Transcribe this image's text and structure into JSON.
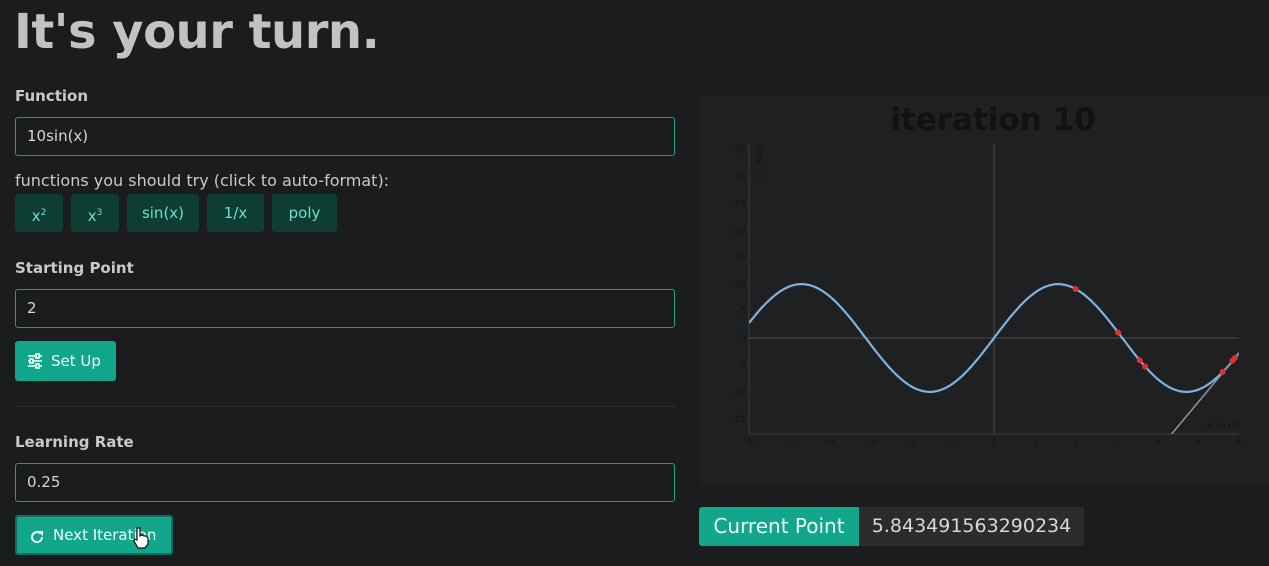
{
  "page": {
    "title": "It's your turn."
  },
  "function": {
    "label": "Function",
    "value": "10sin(x)",
    "hint": "functions you should try (click to auto-format):",
    "suggestions": [
      {
        "base": "x",
        "sup": "2"
      },
      {
        "base": "x",
        "sup": "3"
      },
      {
        "base": "sin(x)",
        "sup": ""
      },
      {
        "base": "1/x",
        "sup": ""
      },
      {
        "base": "poly",
        "sup": ""
      }
    ]
  },
  "starting_point": {
    "label": "Starting Point",
    "value": "2",
    "setup_label": "Set Up",
    "setup_icon": "sliders-icon"
  },
  "learning_rate": {
    "label": "Learning Rate",
    "value": "0.25",
    "next_label": "Next Iteration",
    "next_icon": "refresh-icon"
  },
  "current_point": {
    "label": "Current Point",
    "value": "5.843491563290234"
  },
  "colors": {
    "accent": "#12a68a",
    "curve": "#7fb2e0",
    "points": "#e0302e",
    "tangent": "#8a9096"
  },
  "chart_data": {
    "type": "line",
    "title": "iteration 10",
    "xlabel": "x - axis",
    "ylabel": "y - axis",
    "xlim": [
      -6,
      6
    ],
    "ylim": [
      -18,
      36
    ],
    "xticks": [
      -6,
      -5,
      -4,
      -3,
      -2,
      -1,
      0,
      1,
      2,
      3,
      4,
      5,
      6
    ],
    "yticks": [
      -15,
      -10,
      -5,
      0,
      5,
      10,
      15,
      20,
      25,
      30,
      35
    ],
    "series": [
      {
        "function": "10sin(x)"
      }
    ],
    "points": [
      {
        "x": 2.0,
        "y": 9.09
      },
      {
        "x": 3.04,
        "y": 1.0
      },
      {
        "x": 3.57,
        "y": -4.15
      },
      {
        "x": 3.7,
        "y": -5.3
      },
      {
        "x": 5.6,
        "y": -6.3
      },
      {
        "x": 5.84,
        "y": -4.2
      },
      {
        "x": 5.9,
        "y": -3.7
      }
    ],
    "tangent": {
      "x0": 5.843491563290234,
      "slope": 9.08
    }
  }
}
